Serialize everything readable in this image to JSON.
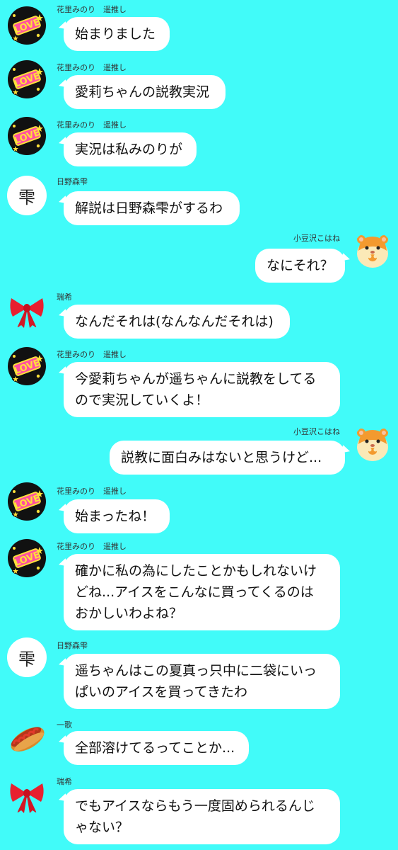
{
  "names": {
    "minori": "花里みのり　遥推し",
    "shizuku": "日野森雫",
    "kohane": "小豆沢こはね",
    "mizuki": "瑞希",
    "ichika": "一歌"
  },
  "shizuku_avatar_glyph": "雫",
  "messages": [
    {
      "text": "始まりました"
    },
    {
      "text": "愛莉ちゃんの説教実況"
    },
    {
      "text": "実況は私みのりが"
    },
    {
      "text": "解説は日野森雫がするわ"
    },
    {
      "text": "なにそれ？"
    },
    {
      "text": "なんだそれは(なんなんだそれは)"
    },
    {
      "text": "今愛莉ちゃんが遥ちゃんに説教をしてる\nので実況していくよ！"
    },
    {
      "text": "説教に面白みはないと思うけど..."
    },
    {
      "text": "始まったね！"
    },
    {
      "text": "確かに私の為にしたことかもしれないけ\nどね...アイスをこんなに買ってくるのは\nおかしいわよね？"
    },
    {
      "text": "遥ちゃんはこの夏真っ只中に二袋にいっ\nぱいのアイスを買ってきたわ"
    },
    {
      "text": "全部溶けてるってことか..."
    },
    {
      "text": "でもアイスならもう一度固められるんじ\nゃない？"
    }
  ],
  "colors": {
    "background": "#41fbf9",
    "bubble": "#ffffff"
  }
}
